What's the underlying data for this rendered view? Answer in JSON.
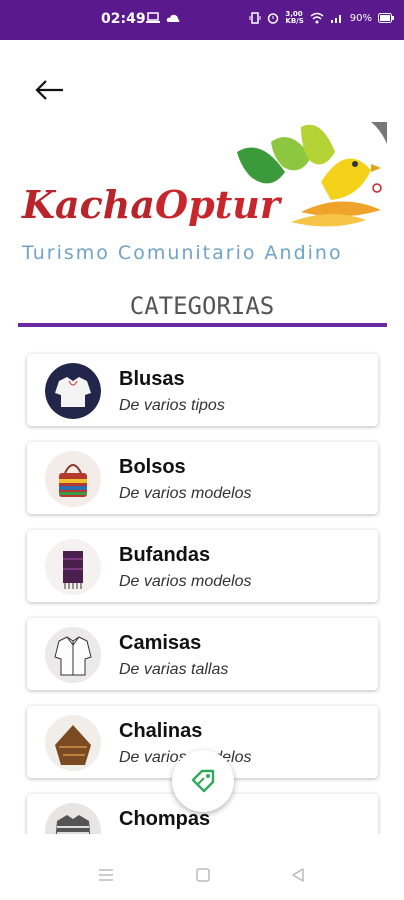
{
  "status": {
    "time": "02:49",
    "speed": "3,00\nKB/S",
    "battery": "90%"
  },
  "logo": {
    "brand_part1": "Kacha",
    "brand_part2": "Optur",
    "tagline": "Turismo Comunitario Andino"
  },
  "header": {
    "title": "CATEGORIAS"
  },
  "categories": [
    {
      "title": "Blusas",
      "subtitle": "De varios tipos"
    },
    {
      "title": "Bolsos",
      "subtitle": "De varios modelos"
    },
    {
      "title": "Bufandas",
      "subtitle": "De varios modelos"
    },
    {
      "title": "Camisas",
      "subtitle": "De varias tallas"
    },
    {
      "title": "Chalinas",
      "subtitle": "De varios modelos"
    },
    {
      "title": "Chompas",
      "subtitle": ""
    }
  ],
  "colors": {
    "status_bar": "#5a1a8e",
    "accent_line": "#6b2aa6",
    "fab_icon": "#2eaa5c"
  },
  "icons": {
    "back": "arrow-left-icon",
    "fab": "tag-icon",
    "nav_menu": "menu-icon",
    "nav_home": "square-icon",
    "nav_back": "triangle-back-icon"
  }
}
